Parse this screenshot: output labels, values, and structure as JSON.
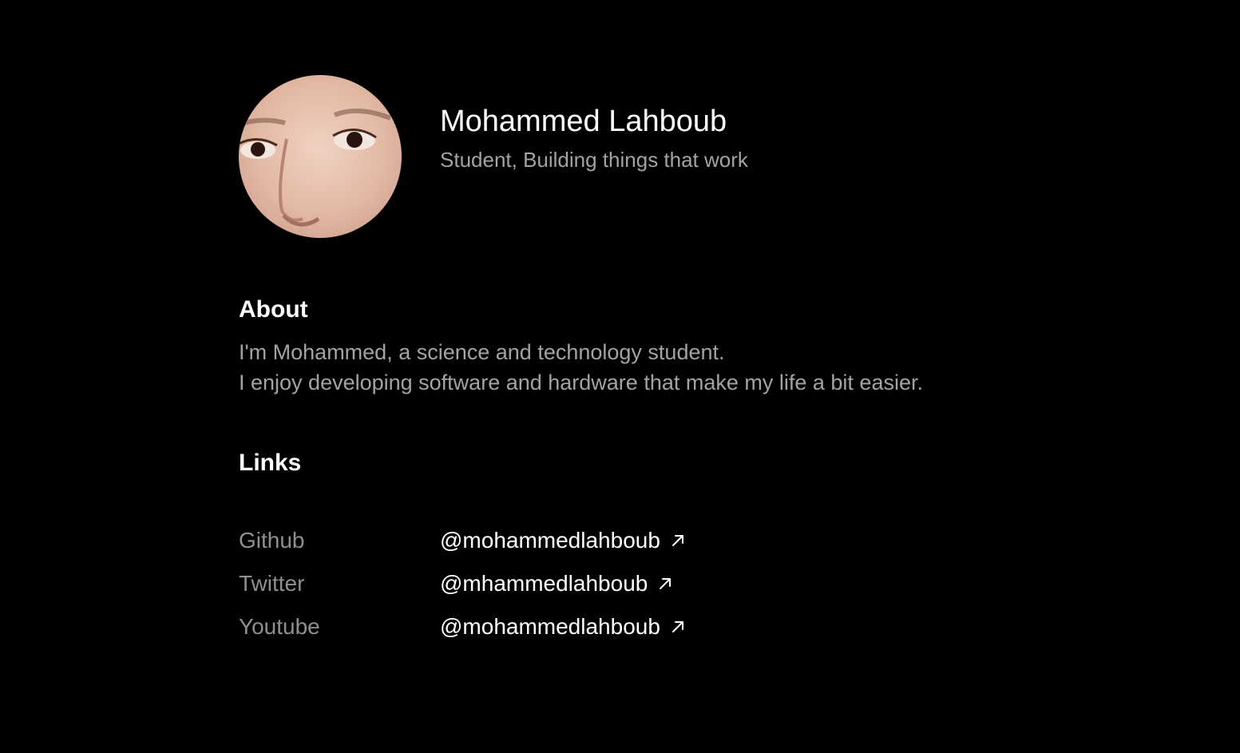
{
  "profile": {
    "name": "Mohammed Lahboub",
    "tagline": "Student, Building things that work",
    "avatar_icon": "avatar-photo"
  },
  "about": {
    "title": "About",
    "line1": "I'm Mohammed, a science and technology student.",
    "line2": "I enjoy developing software and hardware that make my life a bit easier."
  },
  "links": {
    "title": "Links",
    "items": [
      {
        "label": "Github",
        "handle": "@mohammedlahboub",
        "icon": "arrow-up-right-icon"
      },
      {
        "label": "Twitter",
        "handle": "@mhammedlahboub",
        "icon": "arrow-up-right-icon"
      },
      {
        "label": "Youtube",
        "handle": "@mohammedlahboub",
        "icon": "arrow-up-right-icon"
      }
    ]
  },
  "colors": {
    "background": "#000000",
    "primary_text": "#ffffff",
    "secondary_text": "#a3a3a3"
  }
}
